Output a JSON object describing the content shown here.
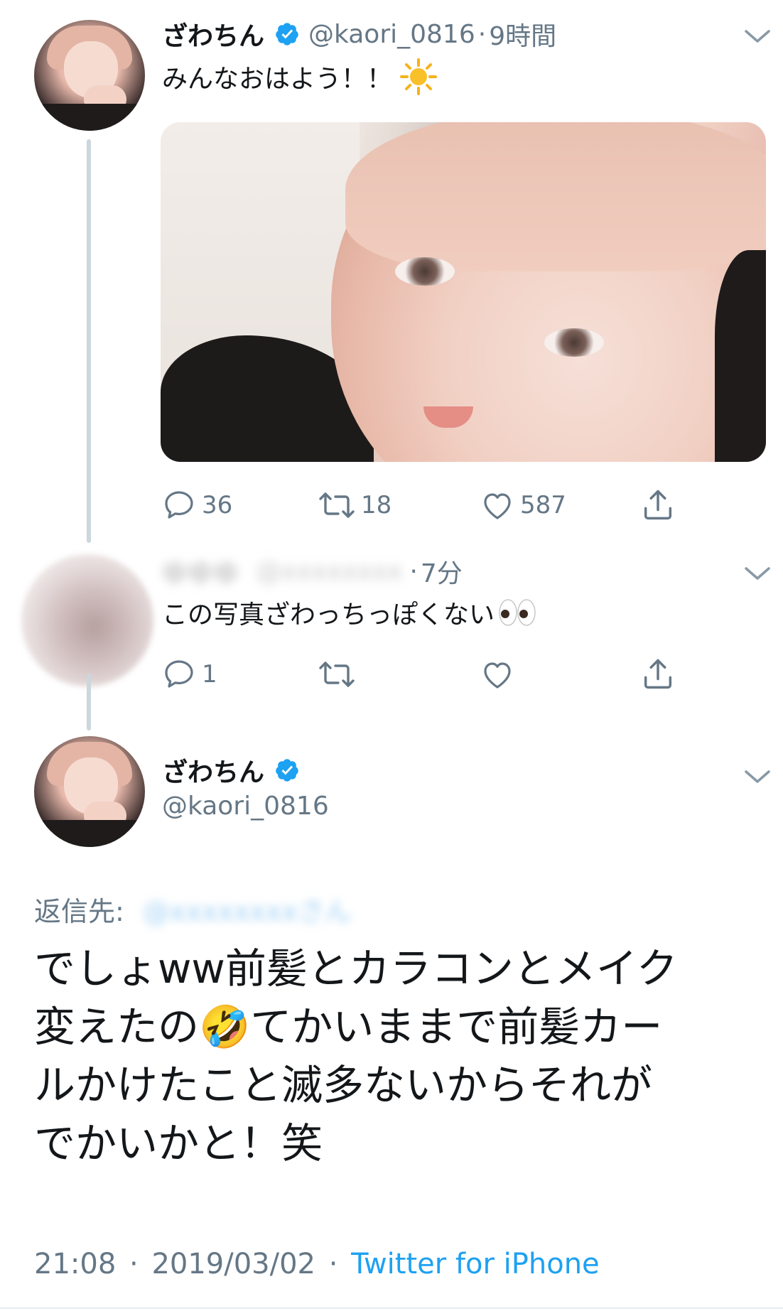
{
  "tweet1": {
    "name": "ざわちん",
    "handle": "@kaori_0816",
    "separator": "·",
    "time": "9時間",
    "text": "みんなおはよう！！",
    "emoji_icon": "sun-emoji",
    "actions": {
      "reply_count": "36",
      "retweet_count": "18",
      "like_count": "587"
    }
  },
  "reply1": {
    "name_blurred": "ゆゆゆ",
    "handle_blurred": "@xxxxxxxx",
    "separator": "·",
    "time": "7分",
    "text": "この写真ざわっちっぽくない",
    "emoji_icon": "eyes-emoji",
    "actions": {
      "reply_count": "1"
    }
  },
  "main_tweet": {
    "name": "ざわちん",
    "handle": "@kaori_0816",
    "reply_to_label": "返信先:",
    "reply_to_target": "@xxxxxxxxさん",
    "text_lines": [
      "でしょww前髪とカラコンとメイク",
      "変えたの🤣てかいままで前髪カー",
      "ルかけたこと滅多ないからそれが",
      "でかいかと！笑"
    ],
    "time": "21:08",
    "date": "2019/03/02",
    "separator": "·",
    "source": "Twitter for iPhone"
  },
  "colors": {
    "accent": "#1da1f2",
    "text": "#14171a",
    "secondary": "#657786",
    "thread_line": "#ccd6dd"
  }
}
